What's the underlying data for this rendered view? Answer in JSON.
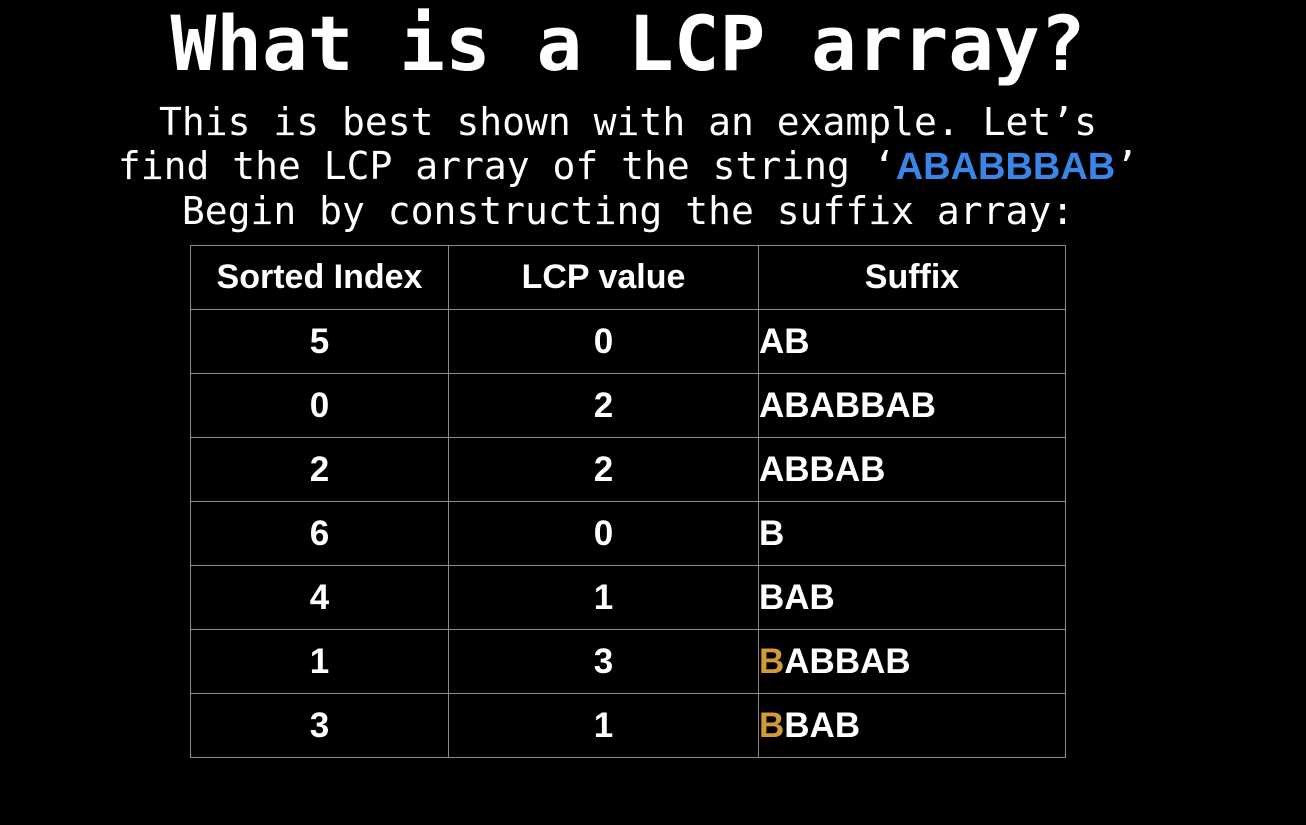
{
  "title": "What is a LCP array?",
  "intro": {
    "line1": "This is best shown with an example. Let’s",
    "line2_prefix": "find the LCP array of the string ‘",
    "string_value": "ABABBBAB",
    "line2_suffix": "’",
    "line3": "Begin by constructing the suffix array:"
  },
  "table": {
    "headers": [
      "Sorted Index",
      "LCP value",
      "Suffix"
    ],
    "rows": [
      {
        "index": "5",
        "lcp": "0",
        "suffix_hl": "",
        "suffix_rest": "AB"
      },
      {
        "index": "0",
        "lcp": "2",
        "suffix_hl": "",
        "suffix_rest": "ABABBAB"
      },
      {
        "index": "2",
        "lcp": "2",
        "suffix_hl": "",
        "suffix_rest": "ABBAB"
      },
      {
        "index": "6",
        "lcp": "0",
        "suffix_hl": "",
        "suffix_rest": "B"
      },
      {
        "index": "4",
        "lcp": "1",
        "suffix_hl": "",
        "suffix_rest": "BAB"
      },
      {
        "index": "1",
        "lcp": "3",
        "suffix_hl": "B",
        "suffix_rest": "ABBAB"
      },
      {
        "index": "3",
        "lcp": "1",
        "suffix_hl": "B",
        "suffix_rest": "BAB"
      }
    ]
  },
  "colors": {
    "background": "#000000",
    "string_highlight": "#3a86e8",
    "suffix_highlight": "#d49a3a"
  }
}
